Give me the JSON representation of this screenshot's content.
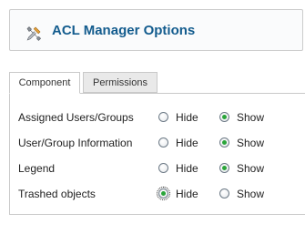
{
  "header": {
    "title": "ACL Manager Options",
    "icon": "tools-icon"
  },
  "tabs": [
    {
      "label": "Component",
      "active": true
    },
    {
      "label": "Permissions",
      "active": false
    }
  ],
  "options": {
    "hide_label": "Hide",
    "show_label": "Show",
    "rows": [
      {
        "label": "Assigned Users/Groups",
        "selected": "Show"
      },
      {
        "label": "User/Group Information",
        "selected": "Show"
      },
      {
        "label": "Legend",
        "selected": "Show"
      },
      {
        "label": "Trashed objects",
        "selected": "Hide"
      }
    ]
  },
  "colors": {
    "title": "#135c8e",
    "radio_checked": "#2aa53a"
  }
}
